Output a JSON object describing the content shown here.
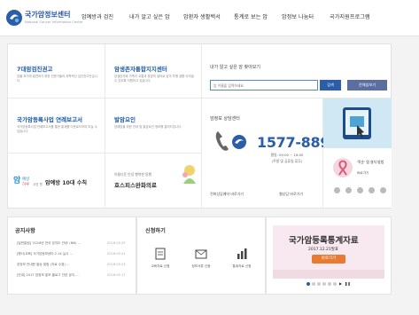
{
  "header": {
    "logo_title": "국가암정보센터",
    "logo_subtitle": "National Cancer Information Center",
    "nav": [
      "암예방과 검진",
      "내가 알고 싶은 암",
      "암환자 생활백서",
      "통계로 보는 암",
      "암정보 나눔터",
      "국가지원프로그램"
    ]
  },
  "cells": {
    "call7": {
      "title": "7대암검진권고",
      "desc": "암을 조기에 발견하기 위한 전문가들의 과학적인 검진권고안입니다."
    },
    "survivor": {
      "title": "암생존자통합지지센터",
      "desc": "암생존자와 가족이 교통과 휴양의 쉼터로 암의 투병 생활 이겨낼 수 있도록 지원하고 있습니다."
    },
    "report": {
      "title": "국가암등록사업 연례보고서",
      "desc": "국가암등록사업 연례보고서를 통한 통계를 다운로드하여 보실 수 있습니다."
    },
    "cause": {
      "title": "발암요인",
      "desc": "암예방을 위한 안내 및 발암요인 정보를 알려드립니다."
    },
    "prevention": {
      "brand": "암예방 하루",
      "brand_sub": "사진 편",
      "title": "암예방 10대 수칙"
    },
    "hospice": {
      "sub": "아름다운 안녕 행복한 동행",
      "title": "호스피스완화의료"
    }
  },
  "search": {
    "label": "내가 알고 싶은 암 찾아보기",
    "placeholder": "암 이름을 입력하세요",
    "search_button": "검색",
    "all_button": "전체암보기"
  },
  "counsel": {
    "title": "암정보 상담센터",
    "phone": "1577-8899",
    "hours_1": "평일: 09:00 ~ 18:00",
    "hours_2": "(주말 및 공휴일 휴무)",
    "link_phone": "전화상담예약 바로가기",
    "link_web": "웹상담 바로가기"
  },
  "right_promo": {
    "text": "'뚝순' 앱 설치 방법",
    "link": "바로가기"
  },
  "notice": {
    "title": "공지사항",
    "rows": [
      {
        "text": "[일반알림] '2018년 전국 암지도 안내' (NN) ...",
        "date": "2018.05.25"
      },
      {
        "text": "[행사/교육] 국가암정보센터 2.14 실시 ...",
        "date": "2018.05.01"
      },
      {
        "text": "암정보 안내문 발송 알림 (자료 수정) ...",
        "date": "2018.05.23"
      },
      {
        "text": "[안내] 2017 암정보 흥보 블로그 관련 공지 ...",
        "date": "2018.05.17"
      }
    ]
  },
  "apply": {
    "title": "신청하기",
    "items": [
      "교육자료 신청",
      "정보서류 신청",
      "통계자료 신청"
    ]
  },
  "banner": {
    "title": "국가암등록통계자료",
    "sub": "2017.12.21발표",
    "button": "바로가기"
  },
  "colors": {
    "brand_blue": "#2b5da8",
    "title_blue": "#1c5aa8",
    "accent_orange": "#e87a32",
    "banner_pink": "#f7e9ef"
  }
}
